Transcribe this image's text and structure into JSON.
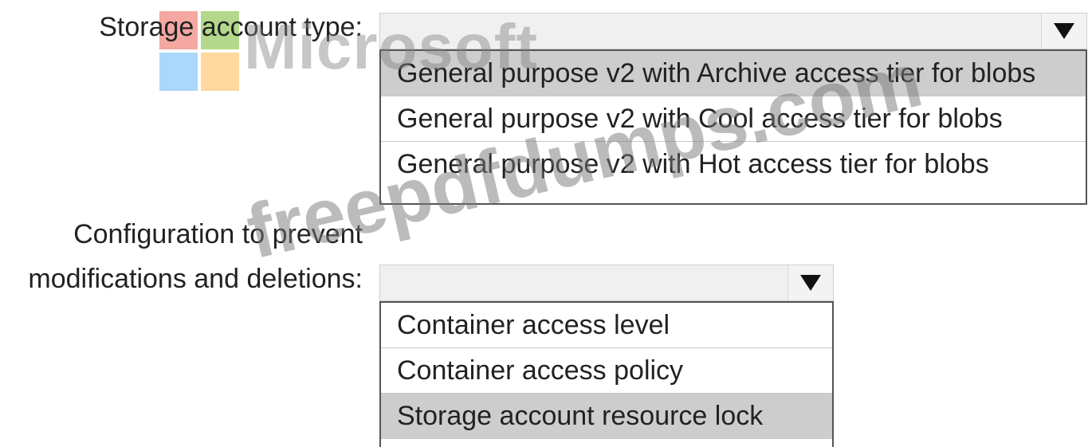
{
  "field1": {
    "label": "Storage account type:",
    "selected_value": "",
    "options": [
      "General purpose v2 with Archive access tier for blobs",
      "General purpose v2 with Cool access tier for blobs",
      "General purpose v2 with Hot access tier for blobs"
    ],
    "highlighted_index": 0
  },
  "field2": {
    "label_line1": "Configuration to prevent",
    "label_line2": "modifications and deletions:",
    "selected_value": "",
    "options": [
      "Container access level",
      "Container access policy",
      "Storage account resource lock"
    ],
    "highlighted_index": 2
  },
  "watermark": {
    "logo_text": "Microsoft",
    "site_text": "freepdfdumps.com"
  },
  "colors": {
    "highlight": "#cdcdcd",
    "combo_bg": "#f0f0f0",
    "logo_red": "#f28b82",
    "logo_green": "#9ccc65",
    "logo_blue": "#90caf9",
    "logo_yellow": "#ffcc80"
  },
  "icons": {
    "dropdown": "dropdown-arrow-icon",
    "logo": "microsoft-logo-icon"
  }
}
